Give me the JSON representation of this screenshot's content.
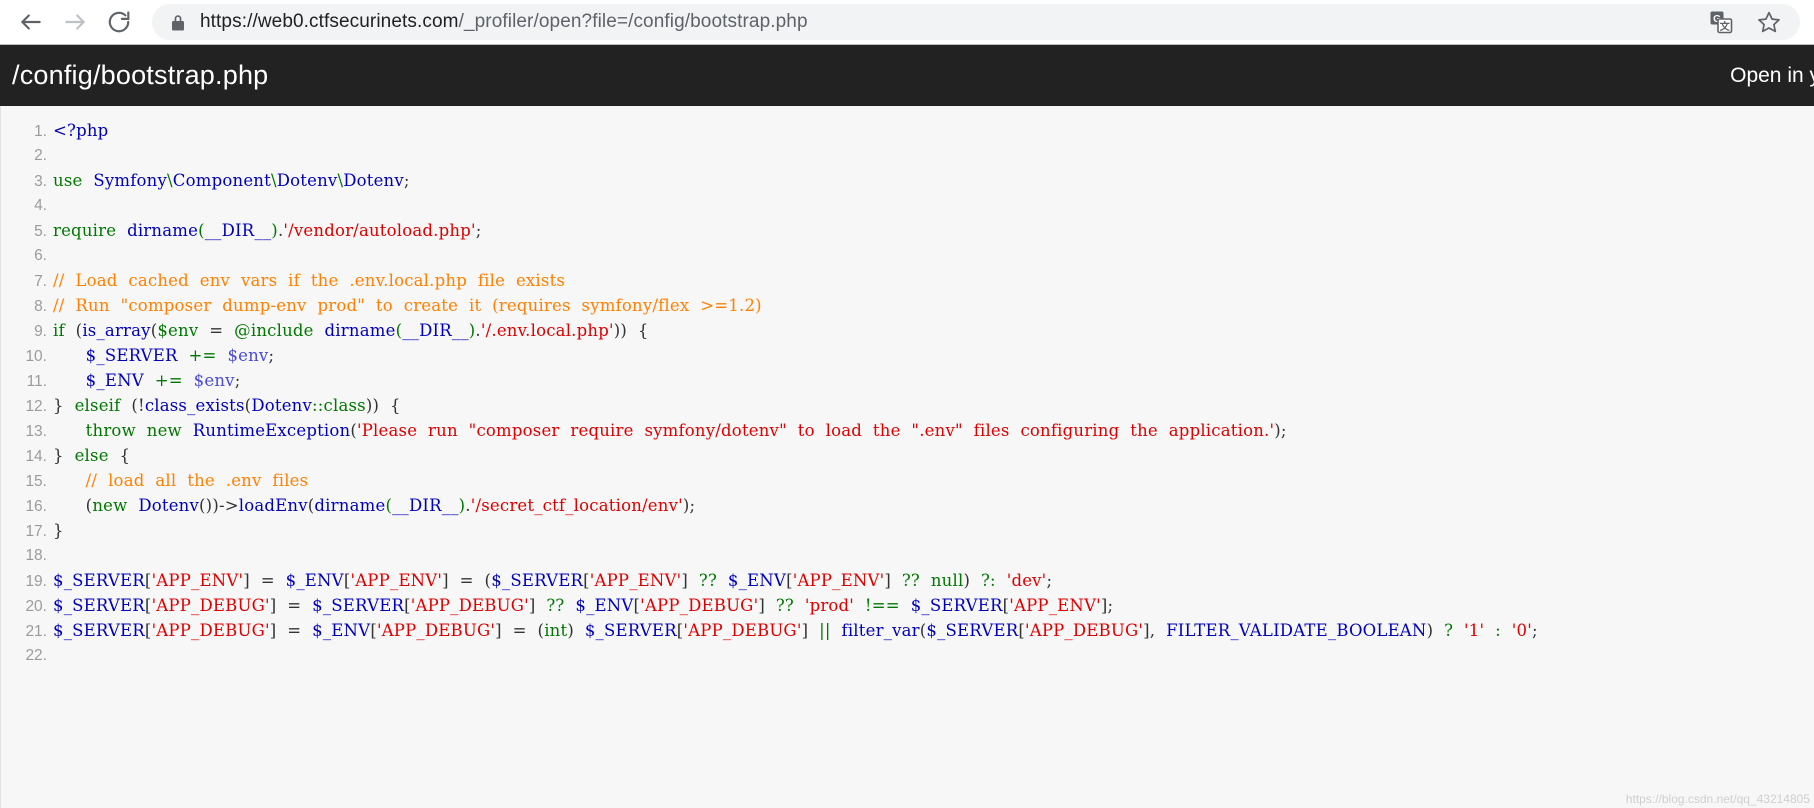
{
  "browser": {
    "back_icon": "arrow-left-icon",
    "forward_icon": "arrow-right-icon",
    "reload_icon": "reload-icon",
    "lock_icon": "lock-icon",
    "url_full": "https://web0.ctfsecurinets.com/_profiler/open?file=/config/bootstrap.php",
    "url_origin": "https://web0.ctfsecurinets.com",
    "url_path": "/_profiler/open?file=/config/bootstrap.php",
    "translate_icon": "google-translate-icon",
    "bookmark_icon": "star-icon"
  },
  "file_header": {
    "title": "/config/bootstrap.php",
    "open_in_label": "Open in y"
  },
  "colors": {
    "header_bg": "#222222",
    "code_bg": "#f7f7f7",
    "line_number": "#9b9b9b",
    "keyword": "#007700",
    "function": "#0000bb",
    "variable": "#0000bb",
    "string": "#dd0000",
    "comment": "#ff8000",
    "default": "#333333",
    "omnibox_bg": "#f1f3f4"
  },
  "watermark": "https://blog.csdn.net/qq_43214805",
  "code": {
    "language": "php",
    "total_lines": 22,
    "lines": [
      {
        "n": "1.",
        "tokens": [
          {
            "t": "&lt;?php",
            "c": "t-fn"
          }
        ]
      },
      {
        "n": "2.",
        "tokens": []
      },
      {
        "n": "3.",
        "tokens": [
          {
            "t": "use",
            "c": "t-kw"
          },
          {
            "t": "  ",
            "c": "t-def"
          },
          {
            "t": "Symfony",
            "c": "t-fn"
          },
          {
            "t": "\\",
            "c": "t-kw"
          },
          {
            "t": "Component",
            "c": "t-fn"
          },
          {
            "t": "\\",
            "c": "t-kw"
          },
          {
            "t": "Dotenv",
            "c": "t-fn"
          },
          {
            "t": "\\",
            "c": "t-kw"
          },
          {
            "t": "Dotenv",
            "c": "t-fn"
          },
          {
            "t": ";",
            "c": "t-punct"
          }
        ]
      },
      {
        "n": "4.",
        "tokens": []
      },
      {
        "n": "5.",
        "tokens": [
          {
            "t": "require",
            "c": "t-kw"
          },
          {
            "t": "  ",
            "c": "t-def"
          },
          {
            "t": "dirname",
            "c": "t-fn"
          },
          {
            "t": "(",
            "c": "t-kw"
          },
          {
            "t": "__DIR__",
            "c": "t-var"
          },
          {
            "t": ")",
            "c": "t-kw"
          },
          {
            "t": ".",
            "c": "t-punct"
          },
          {
            "t": "'/vendor/autoload.php'",
            "c": "t-str"
          },
          {
            "t": ";",
            "c": "t-punct"
          }
        ]
      },
      {
        "n": "6.",
        "tokens": []
      },
      {
        "n": "7.",
        "tokens": [
          {
            "t": "// ",
            "c": "t-cmt"
          },
          {
            "t": " Load  cached  env  vars  if  the  .env.local.php  file  exists",
            "c": "t-cmt"
          }
        ]
      },
      {
        "n": "8.",
        "tokens": [
          {
            "t": "// ",
            "c": "t-cmt"
          },
          {
            "t": " Run  \"composer  dump-env  prod\"  to  create  it  (requires  symfony/flex  >=1.2)",
            "c": "t-cmt"
          }
        ]
      },
      {
        "n": "9.",
        "tokens": [
          {
            "t": "if",
            "c": "t-kw"
          },
          {
            "t": "  (",
            "c": "t-punct"
          },
          {
            "t": "is_array",
            "c": "t-fn"
          },
          {
            "t": "(",
            "c": "t-punct"
          },
          {
            "t": "$env",
            "c": "t-kw"
          },
          {
            "t": "  =  ",
            "c": "t-def"
          },
          {
            "t": "@include",
            "c": "t-kw"
          },
          {
            "t": "  ",
            "c": "t-def"
          },
          {
            "t": "dirname",
            "c": "t-fn"
          },
          {
            "t": "(",
            "c": "t-kw"
          },
          {
            "t": "__DIR__",
            "c": "t-var"
          },
          {
            "t": ")",
            "c": "t-kw"
          },
          {
            "t": ".",
            "c": "t-punct"
          },
          {
            "t": "'/.env.local.php'",
            "c": "t-str"
          },
          {
            "t": "))  {",
            "c": "t-punct"
          }
        ]
      },
      {
        "n": "10.",
        "tokens": [
          {
            "t": "      ",
            "c": "t-def"
          },
          {
            "t": "$_SERVER",
            "c": "t-var"
          },
          {
            "t": "  ",
            "c": "t-def"
          },
          {
            "t": "+=",
            "c": "t-op"
          },
          {
            "t": "  ",
            "c": "t-def"
          },
          {
            "t": "$env",
            "c": "t-var2"
          },
          {
            "t": ";",
            "c": "t-punct"
          }
        ]
      },
      {
        "n": "11.",
        "tokens": [
          {
            "t": "      ",
            "c": "t-def"
          },
          {
            "t": "$_ENV",
            "c": "t-var"
          },
          {
            "t": "  ",
            "c": "t-def"
          },
          {
            "t": "+=",
            "c": "t-op"
          },
          {
            "t": "  ",
            "c": "t-def"
          },
          {
            "t": "$env",
            "c": "t-var2"
          },
          {
            "t": ";",
            "c": "t-punct"
          }
        ]
      },
      {
        "n": "12.",
        "tokens": [
          {
            "t": "}",
            "c": "t-punct"
          },
          {
            "t": "  ",
            "c": "t-def"
          },
          {
            "t": "elseif",
            "c": "t-kw"
          },
          {
            "t": "  (!",
            "c": "t-punct"
          },
          {
            "t": "class_exists",
            "c": "t-fn"
          },
          {
            "t": "(",
            "c": "t-punct"
          },
          {
            "t": "Dotenv",
            "c": "t-fn"
          },
          {
            "t": "::class",
            "c": "t-kw"
          },
          {
            "t": "))  {",
            "c": "t-punct"
          }
        ]
      },
      {
        "n": "13.",
        "tokens": [
          {
            "t": "      ",
            "c": "t-def"
          },
          {
            "t": "throw",
            "c": "t-kw"
          },
          {
            "t": "  ",
            "c": "t-def"
          },
          {
            "t": "new",
            "c": "t-kw"
          },
          {
            "t": "  ",
            "c": "t-def"
          },
          {
            "t": "RuntimeException",
            "c": "t-fn"
          },
          {
            "t": "(",
            "c": "t-punct"
          },
          {
            "t": "'Please  run  \"composer  require  symfony/dotenv\"  to  load  the  \".env\"  files  configuring  the  application.'",
            "c": "t-str"
          },
          {
            "t": ");",
            "c": "t-punct"
          }
        ]
      },
      {
        "n": "14.",
        "tokens": [
          {
            "t": "}",
            "c": "t-punct"
          },
          {
            "t": "  ",
            "c": "t-def"
          },
          {
            "t": "else",
            "c": "t-kw"
          },
          {
            "t": "  {",
            "c": "t-punct"
          }
        ]
      },
      {
        "n": "15.",
        "tokens": [
          {
            "t": "      ",
            "c": "t-def"
          },
          {
            "t": "//  load  all  the  .env  files",
            "c": "t-cmt"
          }
        ]
      },
      {
        "n": "16.",
        "tokens": [
          {
            "t": "      (",
            "c": "t-punct"
          },
          {
            "t": "new",
            "c": "t-kw"
          },
          {
            "t": "  ",
            "c": "t-def"
          },
          {
            "t": "Dotenv",
            "c": "t-fn"
          },
          {
            "t": "())->",
            "c": "t-punct"
          },
          {
            "t": "loadEnv",
            "c": "t-fn"
          },
          {
            "t": "(",
            "c": "t-punct"
          },
          {
            "t": "dirname",
            "c": "t-fn"
          },
          {
            "t": "(",
            "c": "t-kw"
          },
          {
            "t": "__DIR__",
            "c": "t-var"
          },
          {
            "t": ")",
            "c": "t-kw"
          },
          {
            "t": ".",
            "c": "t-punct"
          },
          {
            "t": "'/secret_ctf_location/env'",
            "c": "t-str"
          },
          {
            "t": ");",
            "c": "t-punct"
          }
        ]
      },
      {
        "n": "17.",
        "tokens": [
          {
            "t": "}",
            "c": "t-punct"
          }
        ]
      },
      {
        "n": "18.",
        "tokens": []
      },
      {
        "n": "19.",
        "tokens": [
          {
            "t": "$_SERVER",
            "c": "t-var"
          },
          {
            "t": "[",
            "c": "t-punct"
          },
          {
            "t": "'APP_ENV'",
            "c": "t-str"
          },
          {
            "t": "]",
            "c": "t-punct"
          },
          {
            "t": "  =  ",
            "c": "t-def"
          },
          {
            "t": "$_ENV",
            "c": "t-var"
          },
          {
            "t": "[",
            "c": "t-punct"
          },
          {
            "t": "'APP_ENV'",
            "c": "t-str"
          },
          {
            "t": "]",
            "c": "t-punct"
          },
          {
            "t": "  =  (",
            "c": "t-def"
          },
          {
            "t": "$_SERVER",
            "c": "t-var"
          },
          {
            "t": "[",
            "c": "t-punct"
          },
          {
            "t": "'APP_ENV'",
            "c": "t-str"
          },
          {
            "t": "]",
            "c": "t-punct"
          },
          {
            "t": "  ??  ",
            "c": "t-op"
          },
          {
            "t": "$_ENV",
            "c": "t-var"
          },
          {
            "t": "[",
            "c": "t-punct"
          },
          {
            "t": "'APP_ENV'",
            "c": "t-str"
          },
          {
            "t": "]",
            "c": "t-punct"
          },
          {
            "t": "  ??  ",
            "c": "t-op"
          },
          {
            "t": "null",
            "c": "t-kw"
          },
          {
            "t": ")",
            "c": "t-punct"
          },
          {
            "t": "  ?:  ",
            "c": "t-op"
          },
          {
            "t": "'dev'",
            "c": "t-str"
          },
          {
            "t": ";",
            "c": "t-punct"
          }
        ]
      },
      {
        "n": "20.",
        "tokens": [
          {
            "t": "$_SERVER",
            "c": "t-var"
          },
          {
            "t": "[",
            "c": "t-punct"
          },
          {
            "t": "'APP_DEBUG'",
            "c": "t-str"
          },
          {
            "t": "]",
            "c": "t-punct"
          },
          {
            "t": "  =  ",
            "c": "t-def"
          },
          {
            "t": "$_SERVER",
            "c": "t-var"
          },
          {
            "t": "[",
            "c": "t-punct"
          },
          {
            "t": "'APP_DEBUG'",
            "c": "t-str"
          },
          {
            "t": "]",
            "c": "t-punct"
          },
          {
            "t": "  ??  ",
            "c": "t-op"
          },
          {
            "t": "$_ENV",
            "c": "t-var"
          },
          {
            "t": "[",
            "c": "t-punct"
          },
          {
            "t": "'APP_DEBUG'",
            "c": "t-str"
          },
          {
            "t": "]",
            "c": "t-punct"
          },
          {
            "t": "  ??  ",
            "c": "t-op"
          },
          {
            "t": "'prod'",
            "c": "t-str"
          },
          {
            "t": "  !==  ",
            "c": "t-op"
          },
          {
            "t": "$_SERVER",
            "c": "t-var"
          },
          {
            "t": "[",
            "c": "t-punct"
          },
          {
            "t": "'APP_ENV'",
            "c": "t-str"
          },
          {
            "t": "];",
            "c": "t-punct"
          }
        ]
      },
      {
        "n": "21.",
        "tokens": [
          {
            "t": "$_SERVER",
            "c": "t-var"
          },
          {
            "t": "[",
            "c": "t-punct"
          },
          {
            "t": "'APP_DEBUG'",
            "c": "t-str"
          },
          {
            "t": "]",
            "c": "t-punct"
          },
          {
            "t": "  =  ",
            "c": "t-def"
          },
          {
            "t": "$_ENV",
            "c": "t-var"
          },
          {
            "t": "[",
            "c": "t-punct"
          },
          {
            "t": "'APP_DEBUG'",
            "c": "t-str"
          },
          {
            "t": "]",
            "c": "t-punct"
          },
          {
            "t": "  =  (",
            "c": "t-def"
          },
          {
            "t": "int",
            "c": "t-kw"
          },
          {
            "t": ")  ",
            "c": "t-def"
          },
          {
            "t": "$_SERVER",
            "c": "t-var"
          },
          {
            "t": "[",
            "c": "t-punct"
          },
          {
            "t": "'APP_DEBUG'",
            "c": "t-str"
          },
          {
            "t": "]",
            "c": "t-punct"
          },
          {
            "t": "  ||  ",
            "c": "t-op"
          },
          {
            "t": "filter_var",
            "c": "t-fn"
          },
          {
            "t": "(",
            "c": "t-punct"
          },
          {
            "t": "$_SERVER",
            "c": "t-var"
          },
          {
            "t": "[",
            "c": "t-punct"
          },
          {
            "t": "'APP_DEBUG'",
            "c": "t-str"
          },
          {
            "t": "],",
            "c": "t-punct"
          },
          {
            "t": "  ",
            "c": "t-def"
          },
          {
            "t": "FILTER_VALIDATE_BOOLEAN",
            "c": "t-var"
          },
          {
            "t": ")",
            "c": "t-punct"
          },
          {
            "t": "  ?  ",
            "c": "t-op"
          },
          {
            "t": "'1'",
            "c": "t-str"
          },
          {
            "t": "  :  ",
            "c": "t-op"
          },
          {
            "t": "'0'",
            "c": "t-str"
          },
          {
            "t": ";",
            "c": "t-punct"
          }
        ]
      },
      {
        "n": "22.",
        "tokens": []
      }
    ]
  }
}
